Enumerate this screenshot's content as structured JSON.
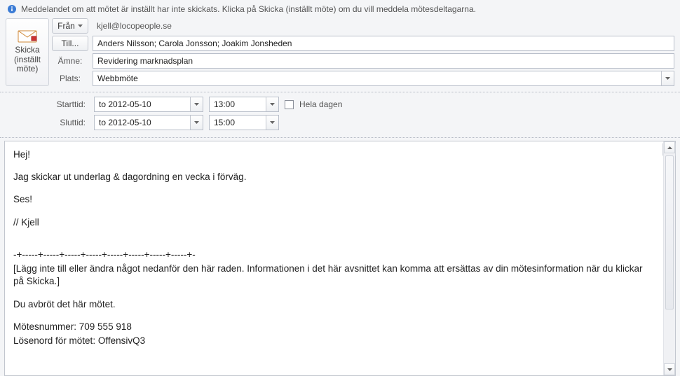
{
  "notice": {
    "text": "Meddelandet om att mötet är inställt har inte skickats. Klicka på Skicka (inställt möte) om du vill meddela mötesdeltagarna."
  },
  "send": {
    "line1": "Skicka",
    "line2": "(inställt",
    "line3": "möte)"
  },
  "fields": {
    "from_label": "Från",
    "from_value": "kjell@locopeople.se",
    "to_label": "Till...",
    "to_value": "Anders Nilsson; Carola Jonsson; Joakim Jonsheden",
    "subject_label": "Ämne:",
    "subject_value": "Revidering marknadsplan",
    "location_label": "Plats:",
    "location_value": "Webbmöte"
  },
  "time": {
    "start_label": "Starttid:",
    "end_label": "Sluttid:",
    "start_date": "to 2012-05-10",
    "start_time": "13:00",
    "end_date": "to 2012-05-10",
    "end_time": "15:00",
    "allday_label": "Hela dagen"
  },
  "body": {
    "p1": "Hej!",
    "p2": "Jag skickar ut underlag & dagordning en vecka i förväg.",
    "p3": "Ses!",
    "p4": "// Kjell",
    "sep": "-+-----+-----+-----+-----+-----+-----+-----+-----+-",
    "warn": "[Lägg inte till eller ändra något nedanför den här raden. Informationen i det här avsnittet kan komma att ersättas av din mötesinformation när du klickar på Skicka.]",
    "cancel": "Du avbröt det här mötet.",
    "mnum": "Mötesnummer: 709 555 918",
    "mpwd": "Lösenord för mötet: OffensivQ3"
  }
}
